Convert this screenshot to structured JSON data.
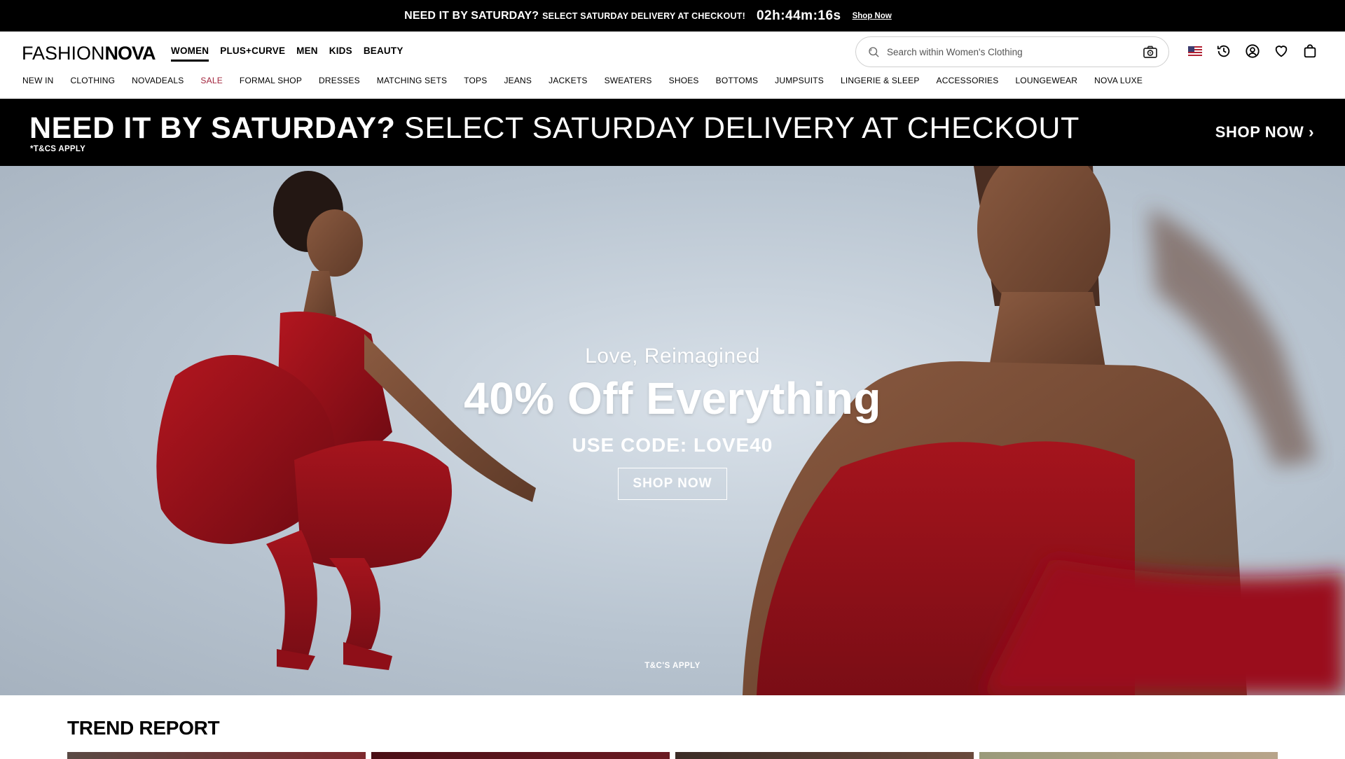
{
  "announcement": {
    "headline": "NEED IT BY SATURDAY?",
    "subtext": "SELECT SATURDAY DELIVERY AT CHECKOUT!",
    "timer": "02h:44m:16s",
    "link": "Shop Now"
  },
  "header": {
    "logo_part1": "FASHION",
    "logo_part2": "NOVA",
    "main_tabs": [
      "WOMEN",
      "PLUS+CURVE",
      "MEN",
      "KIDS",
      "BEAUTY"
    ],
    "active_tab": "WOMEN",
    "search_placeholder": "Search within Women's Clothing",
    "icons": [
      "us-flag-icon",
      "history-icon",
      "account-icon",
      "wishlist-heart-icon",
      "shopping-bag-icon"
    ]
  },
  "categories": [
    "NEW IN",
    "CLOTHING",
    "NOVADEALS",
    "SALE",
    "FORMAL SHOP",
    "DRESSES",
    "MATCHING SETS",
    "TOPS",
    "JEANS",
    "JACKETS",
    "SWEATERS",
    "SHOES",
    "BOTTOMS",
    "JUMPSUITS",
    "LINGERIE & SLEEP",
    "ACCESSORIES",
    "LOUNGEWEAR",
    "NOVA LUXE"
  ],
  "delivery_banner": {
    "bold": "NEED IT BY SATURDAY?",
    "rest": "SELECT SATURDAY DELIVERY AT CHECKOUT",
    "terms": "*T&CS APPLY",
    "cta": "SHOP NOW ›"
  },
  "hero": {
    "kicker": "Love, Reimagined",
    "headline": "40% Off Everything",
    "code": "USE CODE: LOVE40",
    "cta": "SHOP NOW",
    "terms": "T&C'S APPLY"
  },
  "trend": {
    "title": "TREND REPORT"
  },
  "colors": {
    "sale": "#a1243c",
    "dress_red": "#a0121c",
    "background_black": "#000000"
  }
}
